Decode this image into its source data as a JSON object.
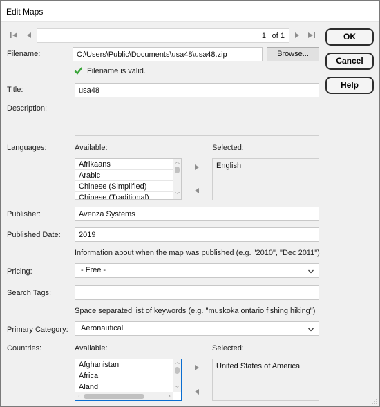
{
  "window": {
    "title": "Edit Maps"
  },
  "pager": {
    "current": "1",
    "of_label": "of 1"
  },
  "dialog_buttons": {
    "ok": "OK",
    "cancel": "Cancel",
    "help": "Help"
  },
  "filename": {
    "label": "Filename:",
    "value": "C:\\Users\\Public\\Documents\\usa48\\usa48.zip",
    "browse": "Browse...",
    "validation": "Filename is valid."
  },
  "title_field": {
    "label": "Title:",
    "value": "usa48"
  },
  "description": {
    "label": "Description:",
    "value": ""
  },
  "languages": {
    "label": "Languages:",
    "available_label": "Available:",
    "selected_label": "Selected:",
    "available": [
      "Afrikaans",
      "Arabic",
      "Chinese (Simplified)",
      "Chinese (Traditional)"
    ],
    "selected": [
      "English"
    ]
  },
  "publisher": {
    "label": "Publisher:",
    "value": "Avenza Systems"
  },
  "published_date": {
    "label": "Published Date:",
    "value": "2019",
    "hint": "Information about when the map was published (e.g. \"2010\", \"Dec 2011\")"
  },
  "pricing": {
    "label": "Pricing:",
    "value": "- Free -"
  },
  "search_tags": {
    "label": "Search Tags:",
    "value": "",
    "hint": "Space separated list of keywords (e.g. \"muskoka ontario fishing hiking\")"
  },
  "primary_category": {
    "label": "Primary Category:",
    "value": "Aeronautical"
  },
  "countries": {
    "label": "Countries:",
    "available_label": "Available:",
    "selected_label": "Selected:",
    "available": [
      "Afghanistan",
      "Africa",
      "Aland"
    ],
    "selected": [
      "United States of America"
    ]
  },
  "colors": {
    "valid_check": "#3aa53a",
    "dialog_border": "#2d2d2d",
    "focus_border": "#0a6ed1"
  }
}
